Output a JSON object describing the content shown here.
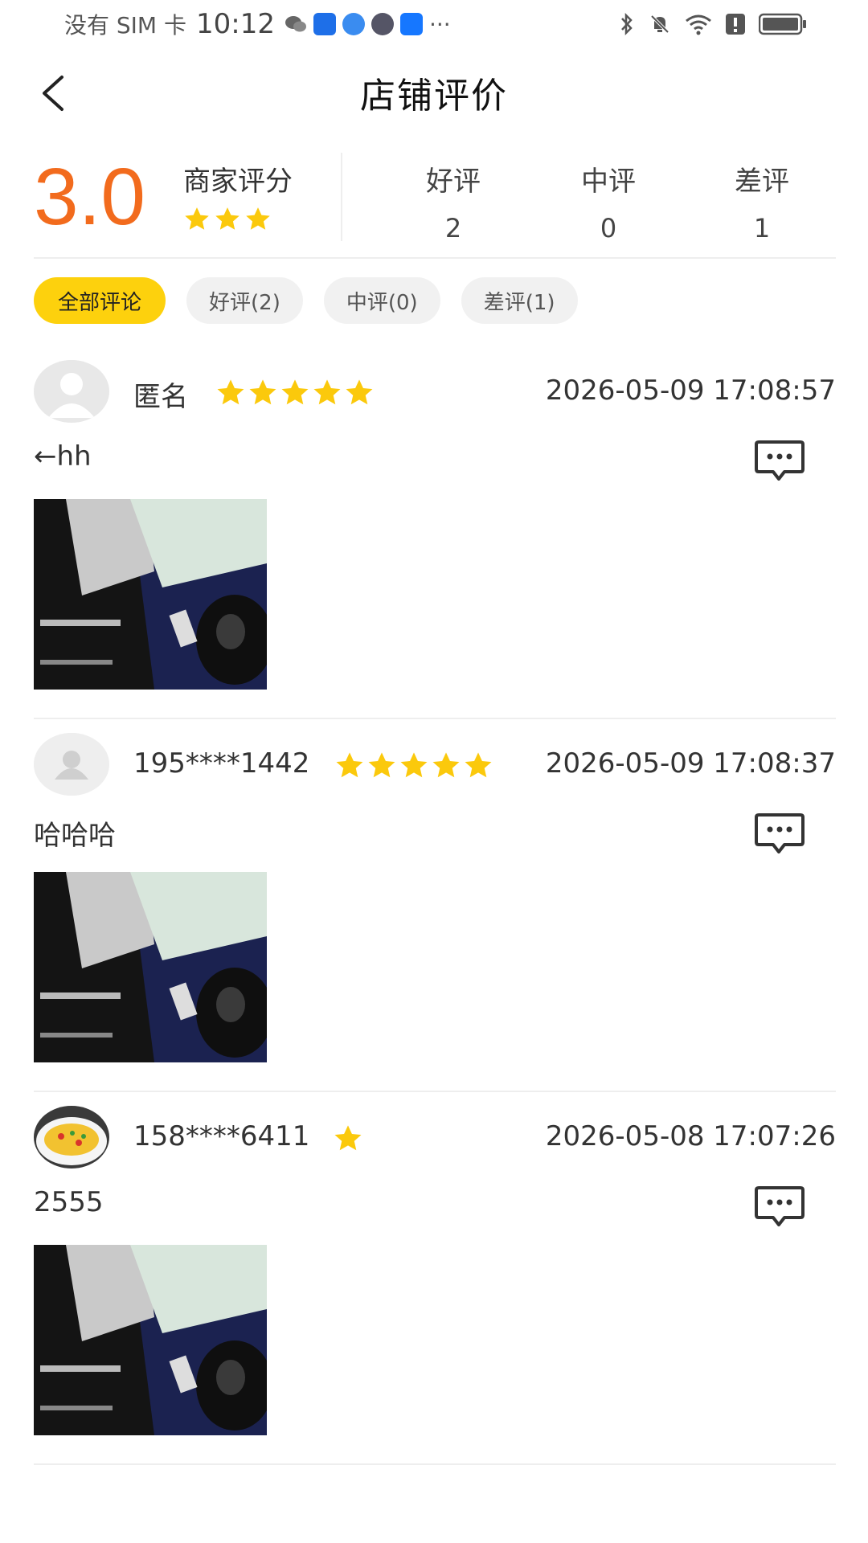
{
  "status_bar": {
    "carrier": "没有 SIM 卡",
    "time": "10:12",
    "more": "···"
  },
  "header": {
    "title": "店铺评价",
    "back_icon": "chevron-left-icon"
  },
  "summary": {
    "score": "3.0",
    "score_label": "商家评分",
    "score_stars": 3,
    "stats": [
      {
        "label": "好评",
        "count": "2"
      },
      {
        "label": "中评",
        "count": "0"
      },
      {
        "label": "差评",
        "count": "1"
      }
    ]
  },
  "filters": [
    {
      "label": "全部评论",
      "active": true
    },
    {
      "label": "好评(2)",
      "active": false
    },
    {
      "label": "中评(0)",
      "active": false
    },
    {
      "label": "差评(1)",
      "active": false
    }
  ],
  "reviews": [
    {
      "user": "匿名",
      "stars": 5,
      "date": "2026-05-09 17:08:57",
      "text": "←hh",
      "avatar": "default-avatar"
    },
    {
      "user": "195****1442",
      "stars": 5,
      "date": "2026-05-09 17:08:37",
      "text": "哈哈哈",
      "avatar": "default-avatar"
    },
    {
      "user": "158****6411",
      "stars": 1,
      "date": "2026-05-08 17:07:26",
      "text": "2555",
      "avatar": "food-photo-avatar"
    }
  ],
  "colors": {
    "accent_orange": "#f26b1d",
    "star_yellow": "#fbc90c",
    "chip_active": "#fdd10d",
    "chip_inactive": "#f1f1f1"
  }
}
